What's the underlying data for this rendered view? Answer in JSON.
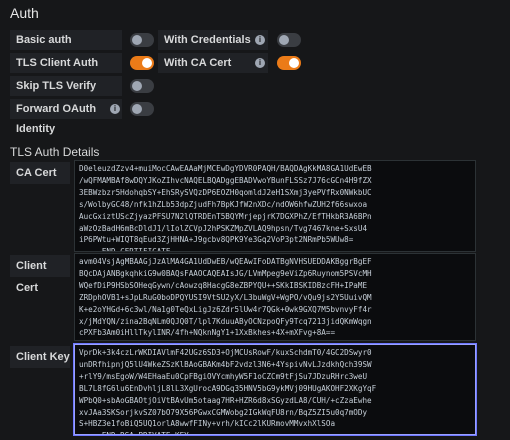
{
  "page_title": "Auth",
  "auth_options": [
    {
      "label": "Basic auth",
      "enabled": false,
      "has_info": false
    },
    {
      "label": "With Credentials",
      "enabled": false,
      "has_info": true
    },
    {
      "label": "TLS Client Auth",
      "enabled": true,
      "has_info": false
    },
    {
      "label": "With CA Cert",
      "enabled": true,
      "has_info": true
    },
    {
      "label": "Skip TLS Verify",
      "enabled": false,
      "has_info": false
    },
    {
      "label": "Forward OAuth Identity",
      "enabled": false,
      "has_info": true
    }
  ],
  "tls_section_title": "TLS Auth Details",
  "fields": [
    {
      "label": "CA Cert",
      "info_icon": true,
      "value": "D0eleuzdZzv4+muiMocCAwEAAaMjMCEwDgYDVR0PAQH/BAQDAgKkMA8GA1UdEwEB\n/wQFMAMBAf8wDQYJKoZIhvcNAQELBQADggEBADVwoYBunFLSSz7J76cGCn4H9fZX\n3EBWzbzr5HdohqbSY+EhSRySVQzDP6EOZH0qomldJ2eH1SXmj3yePVfRx0NWkbUC\ns/WolbyGC48/nfk1hZLb53dpZjudFh7BpKJfW2nXDc/ndOW6hfwZUH2f66swxoa\nAucGxiztUScZjyazPFSU7N2lQTRDEnT5BQYMrjepjrK7DGXPhZ/EfTHkbR3A6BPn\naWzOzBadH6mBcDldJ1/lIolZCVpJ2hPSKZMpZVLAQ9hpsn/Tvg7467kne+SxsU4\niP6PWtu+WIQT8qEud3ZjHHNA+J9gcbv8QPK9Ye3Gq2VoP3pt2NRmPb5WUw8=\n-----END CERTIFICATE-----"
    },
    {
      "label": "Client Cert",
      "info_icon": false,
      "value": "avm04VsjAgMBAAGjJzAlMA4GA1UdDwEB/wQEAwIFoDATBgNVHSUEDDAKBggrBgEF\nBQcDAjANBgkqhkiG9w0BAQsFAAOCAQEAIsJG/LVmMpeg9eViZp6Ruynom5PSVcMH\nWQefDiP9HSbSOHeqGywn/cAowzq8HacgG8eZBPYQU++SKkIBSKIDBzcFH+IPaME\nZRDphOVB1+sJpLRuG0boDPQYUSI9VtSU2yX/L3buWgV+WgPO/vQu9js2Y5UuivQM\nK+e2oYHGd+6c3wl/Na1g0TeQxLigJz6Zdr5lUw4r7QGk+0wk9GXQ7M5bvnvyFf4r\nx/jMdYQN/zina2BqNLm0QJQ0T/lpl7KduuAByOCNzpoQFy9Tcq7213jidQKmWqgn\ncPXFb3Am0iHllTkylINR/4fh+NQknNgY1+1XxBkhes+4X+mXFvg+8A==\n-----END CERTIFICATE-----"
    },
    {
      "label": "Client Key",
      "info_icon": false,
      "value": "VprDk+3k4czLrWKDIAVlmF42UGz6SD3+OjMCUsRowF/kuxSchdmT0/4GC2DSwyr0\nunDRfhipnjQ5lU4WkeZSzKlBAoGBAKm4bF2vdzl3N6+4YspivNvLJzdkhQch39SW\n+rlY9/msEgoW/W4EHaaEu0CpFBgiOVYcmhyW5F1oCZCm9tFjSu7JDzuRHrc3weU\nBL7L8fG6lu6EnDvhljL8lL3XgUrocA9DGq35HNV5bG9ykMVj09HUgAKOHF2XKgYqF\nWPbQ0+sbAoGBAOtjOiVtBAvUm5otaag7HR+HZR6d8xSGyzdLA8/CUH/+cZzaEwhe\nxvJAa3SKSorjkvSZ07bO79X56PGwxCGMWobg2IGkWqFU8rn/BqZ5ZI5u0q7mODy\nS+HBZ3e1foBiQ5UQ1orlA8wwfFINy+vrh/kICc2lKURmovMMvxhXlSOa\n-----END RSA PRIVATE KEY-----"
    }
  ]
}
